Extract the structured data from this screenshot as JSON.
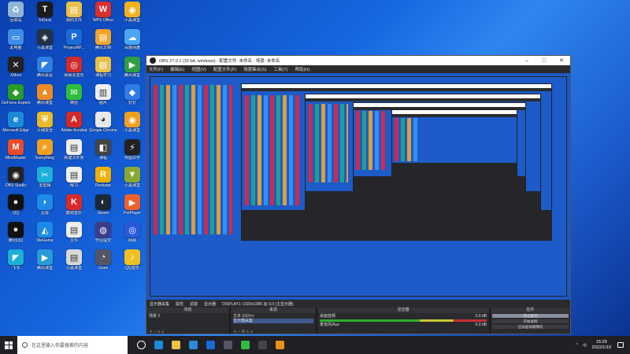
{
  "desktop": {
    "icons": [
      {
        "label": "回收站",
        "color": "#8fb5d8",
        "glyph": "♻"
      },
      {
        "label": "ToDesk",
        "color": "#1b1b1b",
        "glyph": "T"
      },
      {
        "label": "我的文件",
        "color": "#e8c04a",
        "glyph": "▤"
      },
      {
        "label": "WPS Office",
        "color": "#d9302c",
        "glyph": "W"
      },
      {
        "label": "小黑课堂",
        "color": "#f2b21b",
        "glyph": "◉"
      },
      {
        "label": "此电脑",
        "color": "#3d8ee8",
        "glyph": "▭"
      },
      {
        "label": "小黑课堂",
        "color": "#234",
        "glyph": "◈"
      },
      {
        "label": "ProjectRP...",
        "color": "#1a6ad8",
        "glyph": "P"
      },
      {
        "label": "腾讯文档",
        "color": "#f3a32b",
        "glyph": "▤"
      },
      {
        "label": "百度网盘",
        "color": "#4aa6f0",
        "glyph": "☁"
      },
      {
        "label": "XMind",
        "color": "#222",
        "glyph": "✕"
      },
      {
        "label": "腾讯会议",
        "color": "#2f7de0",
        "glyph": "◤"
      },
      {
        "label": "网易云音乐",
        "color": "#d02a2a",
        "glyph": "◎"
      },
      {
        "label": "课程学习",
        "color": "#e8c04a",
        "glyph": "▤"
      },
      {
        "label": "腾讯课堂",
        "color": "#2f9e44",
        "glyph": "▶"
      },
      {
        "label": "GeForce Experience",
        "color": "#2a9a2a",
        "glyph": "◆"
      },
      {
        "label": "腾讯课堂",
        "color": "#ee8a22",
        "glyph": "▲"
      },
      {
        "label": "微信",
        "color": "#2fbe3c",
        "glyph": "✉"
      },
      {
        "label": "图片",
        "color": "#eee",
        "glyph": "▥"
      },
      {
        "label": "钉钉",
        "color": "#2f7be8",
        "glyph": "◆"
      },
      {
        "label": "Microsoft Edge",
        "color": "#1d8ad8",
        "glyph": "e"
      },
      {
        "label": "火绒安全",
        "color": "#e8b92a",
        "glyph": "⛨"
      },
      {
        "label": "Adobe Acrobat",
        "color": "#d12a2a",
        "glyph": "A"
      },
      {
        "label": "Google Chrome",
        "color": "#e8e8e8",
        "glyph": "◕"
      },
      {
        "label": "小黑课堂",
        "color": "#f0a020",
        "glyph": "◉"
      },
      {
        "label": "MindMaster",
        "color": "#e84b2a",
        "glyph": "M"
      },
      {
        "label": "Everything",
        "color": "#f0a020",
        "glyph": "⌕"
      },
      {
        "label": "新建文件夹",
        "color": "#eee",
        "glyph": "▤"
      },
      {
        "label": "课程",
        "color": "#444",
        "glyph": "◧"
      },
      {
        "label": "传图识字",
        "color": "#222",
        "glyph": "⚡"
      },
      {
        "label": "OBS Studio",
        "color": "#222",
        "glyph": "◉"
      },
      {
        "label": "爱剪辑",
        "color": "#1ab0d8",
        "glyph": "✂"
      },
      {
        "label": "练习",
        "color": "#eee",
        "glyph": "▤"
      },
      {
        "label": "Rockstar",
        "color": "#f0b000",
        "glyph": "R"
      },
      {
        "label": "小黑课堂",
        "color": "#8a3",
        "glyph": "▼"
      },
      {
        "label": "QQ",
        "color": "#111",
        "glyph": "●"
      },
      {
        "label": "迅雷",
        "color": "#1d8ae8",
        "glyph": "◗"
      },
      {
        "label": "酷狗音乐",
        "color": "#d82a2a",
        "glyph": "K"
      },
      {
        "label": "Steam",
        "color": "#1b2838",
        "glyph": "◐"
      },
      {
        "label": "PotPlayer",
        "color": "#f0602a",
        "glyph": "▶"
      },
      {
        "label": "腾讯QQ",
        "color": "#111",
        "glyph": "●"
      },
      {
        "label": "WeGame",
        "color": "#1d8ae8",
        "glyph": "◭"
      },
      {
        "label": "文件",
        "color": "#eee",
        "glyph": "▤"
      },
      {
        "label": "作业提交",
        "color": "#3d3d8a",
        "glyph": "◍"
      },
      {
        "label": "网易",
        "color": "#2a5ad8",
        "glyph": "◎"
      },
      {
        "label": "飞书",
        "color": "#1ab0d8",
        "glyph": "◤"
      },
      {
        "label": "腾讯课堂",
        "color": "#2a9ad8",
        "glyph": "▶"
      },
      {
        "label": "小黑课堂",
        "color": "#d8d8d8",
        "glyph": "▤"
      },
      {
        "label": "Geek",
        "color": "#556",
        "glyph": "◔"
      },
      {
        "label": "QQ音乐",
        "color": "#f0c020",
        "glyph": "♪"
      }
    ]
  },
  "obs": {
    "title": "OBS 27.0.1 (32-bit, windows) - 配置文件: 未命名 - 场景: 未命名",
    "menu": [
      "文件(F)",
      "编辑(E)",
      "视图(V)",
      "配置文件(P)",
      "场景集合(S)",
      "工具(T)",
      "帮助(H)"
    ],
    "source_bar": [
      "显示器采集",
      "属性",
      "滤镜",
      "显示器",
      "DISPLAY1: 1920x1080 @ 0,0 (主显示器)"
    ],
    "docks": {
      "scenes": {
        "title": "场景",
        "items": [
          "场景 2"
        ]
      },
      "sources": {
        "title": "来源",
        "items": [
          "文本 (GDI+)",
          "显示器采集"
        ]
      },
      "mixer": {
        "title": "混音器",
        "items": [
          {
            "name": "桌面音频",
            "level": "0.0 dB"
          },
          {
            "name": "麦克风/Aux",
            "level": "0.0 dB"
          }
        ]
      },
      "controls": {
        "title": "控件",
        "buttons": [
          "停止推流",
          "开始录制",
          "启动虚拟摄像机",
          "工作室模式",
          "设置",
          "退出"
        ]
      },
      "transitions": {
        "title": "转场特效",
        "type": "渐变",
        "duration_label": "时长",
        "duration": "300 ms"
      }
    },
    "status": {
      "live": "LIVE: 00:00:00",
      "rec": "REC: 00:00:00",
      "cpu": "CPU: 1.1%, 30.00 fps"
    }
  },
  "taskbar": {
    "search_placeholder": "在这里输入你要搜索的内容",
    "apps": [
      {
        "name": "task-view",
        "color": "#fff"
      },
      {
        "name": "edge",
        "color": "#1d8ad8"
      },
      {
        "name": "file-explorer",
        "color": "#e8c04a"
      },
      {
        "name": "store",
        "color": "#2a8ad8"
      },
      {
        "name": "mail",
        "color": "#1a6ad8"
      },
      {
        "name": "steam",
        "color": "#556"
      },
      {
        "name": "wechat",
        "color": "#2fbe3c"
      },
      {
        "name": "obs",
        "color": "#444"
      },
      {
        "name": "app-orange",
        "color": "#e8901a"
      }
    ],
    "tray_arrow": "^",
    "tray_lang": "中",
    "time": "15:29",
    "date": "2022/1/10"
  }
}
